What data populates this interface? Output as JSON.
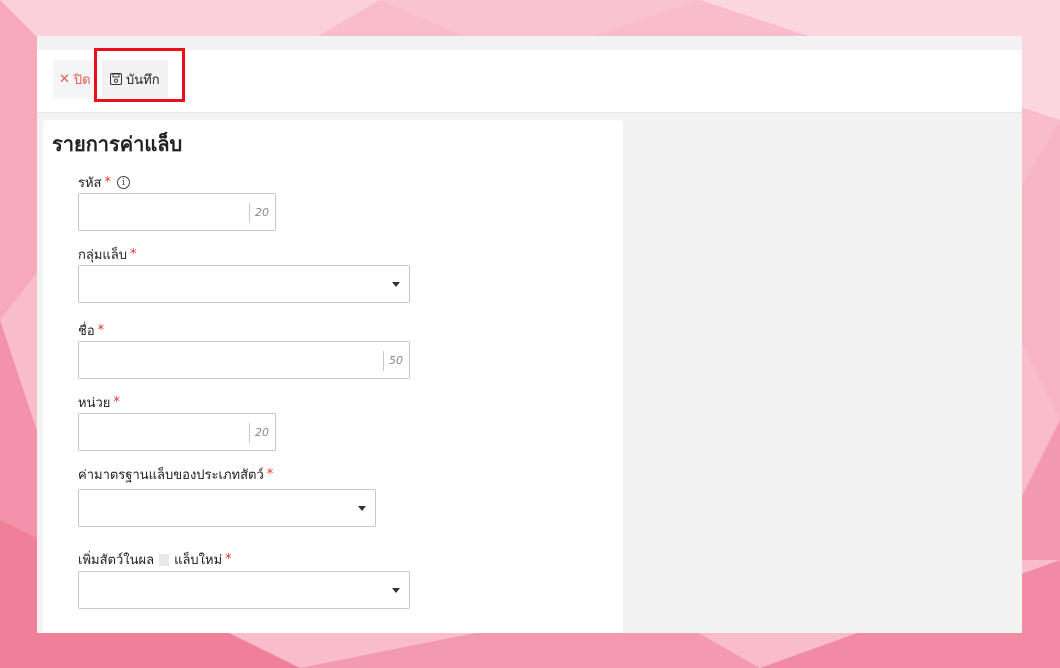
{
  "toolbar": {
    "close_label": "ปิด",
    "save_label": "บันทึก"
  },
  "panel": {
    "title": "รายการค่าแล็บ"
  },
  "fields": {
    "code": {
      "label": "รหัส",
      "required_mark": "*",
      "value": "",
      "max": "20"
    },
    "lab_group": {
      "label": "กลุ่มแล็บ",
      "required_mark": "*",
      "value": ""
    },
    "name": {
      "label": "ชื่อ",
      "required_mark": "*",
      "value": "",
      "max": "50"
    },
    "unit": {
      "label": "หน่วย",
      "required_mark": "*",
      "value": "",
      "max": "20"
    },
    "animal_standard": {
      "label": "ค่ามาตรฐานแล็บของประเภทสัตว์",
      "required_mark": "*",
      "value": ""
    },
    "add_animal": {
      "label_a": "เพิ่มสัตว์ในผล",
      "label_b": "แล็บใหม่",
      "required_mark": "*",
      "value": ""
    }
  },
  "colors": {
    "accent_red": "#e0322b",
    "highlight": "#e8101a",
    "background_pink": "#f7b3c2"
  }
}
